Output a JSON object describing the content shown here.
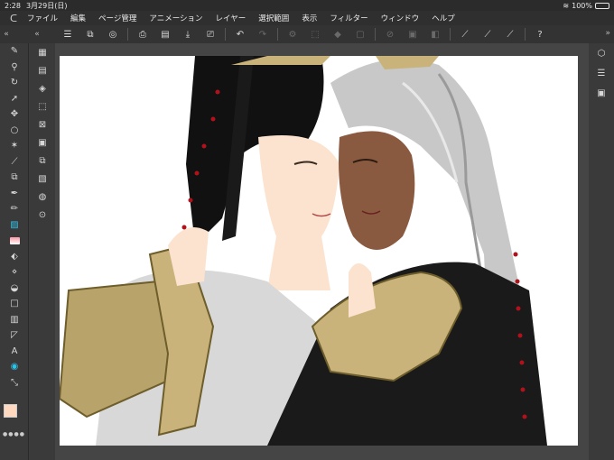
{
  "status": {
    "time": "2:28",
    "date": "3月29日(日)",
    "battery": "100%"
  },
  "menu": {
    "items": [
      "ファイル",
      "編集",
      "ページ管理",
      "アニメーション",
      "レイヤー",
      "選択範囲",
      "表示",
      "フィルター",
      "ウィンドウ",
      "ヘルプ"
    ]
  },
  "toolbar": {
    "icons": [
      "menu-icon",
      "new-canvas-icon",
      "open-icon",
      "save-icon",
      "print-icon",
      "undo-icon",
      "redo-icon",
      "deselect-icon",
      "transform-icon",
      "fill-icon",
      "clear-icon",
      "crop-icon",
      "hide-selection-icon",
      "snap-ruler-icon",
      "snap-special-icon",
      "snap-grid-icon",
      "help-icon"
    ]
  },
  "tools": [
    "pen-settings",
    "zoom",
    "rotate",
    "move-layer",
    "lasso",
    "eyedropper",
    "copy-layer",
    "pen",
    "pencil",
    "brush",
    "airbrush",
    "eraser",
    "blend",
    "fill",
    "rect-select",
    "gradient",
    "figure",
    "text",
    "speech-balloon",
    "operation"
  ],
  "colors": {
    "main": "#ffd8c0",
    "sub": "#6a0d1a",
    "accent": "#2ec2e8"
  },
  "canvas": {
    "image_description_name": "artwork"
  }
}
